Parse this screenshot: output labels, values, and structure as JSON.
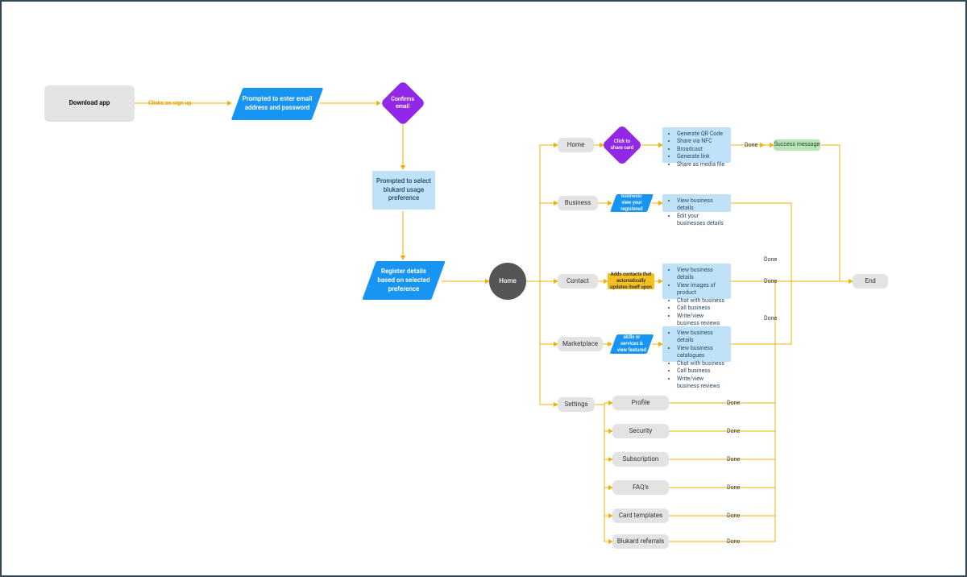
{
  "start": {
    "download": "Download app",
    "signupLabel": "Clicks on sign up"
  },
  "onboard": {
    "enterEmail": "Prompted to enter email address and password",
    "confirmEmail": "Confirms email",
    "selectPref": "Prompted to select blukard usage preference",
    "registerDetails": "Register details based on selected preference"
  },
  "homeCircle": "Home",
  "branches": {
    "home": {
      "label": "Home",
      "decision": "Click to share card",
      "list": [
        "Generate QR Code",
        "Share via NFC",
        "Broadcast",
        "Generate link",
        "Share as media file"
      ],
      "done": "Done",
      "success": "Success message"
    },
    "business": {
      "label": "Business",
      "action": "Search business/ view your registered business",
      "list": [
        "View business details",
        "Edit your businesses details"
      ],
      "done": "Done"
    },
    "contact": {
      "label": "Contact",
      "action": "Adds contacts that automatically updates itself upon",
      "list": [
        "View business details",
        "View images of product",
        "Chat with business",
        "Call business",
        "Write/view business reviews"
      ],
      "done": "Done"
    },
    "marketplace": {
      "label": "Marketplace",
      "action": "Search for skills or services & view featured business",
      "list": [
        "View business details",
        "View business catalogues",
        "Chat with business",
        "Call business",
        "Write/view business reviews"
      ],
      "done": "Done"
    }
  },
  "settings": {
    "label": "Settings",
    "items": [
      {
        "label": "Profile",
        "done": "Done"
      },
      {
        "label": "Security",
        "done": "Done"
      },
      {
        "label": "Subscription",
        "done": "Done"
      },
      {
        "label": "FAQ's",
        "done": "Done"
      },
      {
        "label": "Card templates",
        "done": "Done"
      },
      {
        "label": "Blukard referrals",
        "done": "Done"
      }
    ]
  },
  "end": "End"
}
